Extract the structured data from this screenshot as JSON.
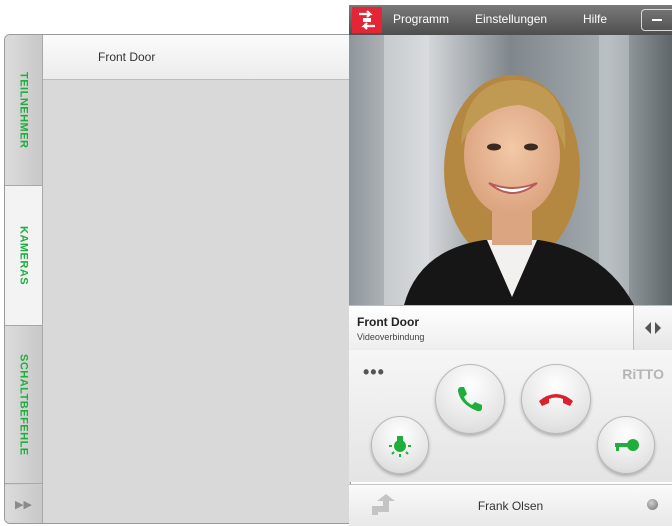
{
  "menu": {
    "programm": "Programm",
    "einstellungen": "Einstellungen",
    "hilfe": "Hilfe"
  },
  "tabs": {
    "teilnehmer": "TEILNEHMER",
    "kameras": "KAMERAS",
    "schaltbefehle": "SCHALTBEFEHLE"
  },
  "list": {
    "items": [
      "Front Door"
    ]
  },
  "call": {
    "name": "Front Door",
    "status": "Videoverbindung"
  },
  "controls": {
    "more": "•••",
    "brand": "RiTTO"
  },
  "footer": {
    "user": "Frank Olsen"
  },
  "colors": {
    "accent_green": "#1fae3c",
    "hangup_red": "#d9212f",
    "logo_red": "#e42535"
  }
}
